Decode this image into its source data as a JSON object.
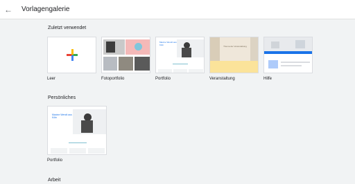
{
  "header": {
    "title": "Vorlagengalerie"
  },
  "sections": [
    {
      "title": "Zuletzt verwendet"
    },
    {
      "title": "Persönliches"
    },
    {
      "title": "Arbeit"
    }
  ],
  "recent": [
    {
      "label": "Leer"
    },
    {
      "label": "Fotoportfolio"
    },
    {
      "label": "Portfolio"
    },
    {
      "label": "Veranstaltung"
    },
    {
      "label": "Hilfe"
    }
  ],
  "personal": [
    {
      "label": "Portfolio"
    }
  ],
  "previews": {
    "portfolio_heading": "Maxine Wendt aus Köln",
    "event_heading": "Thema der Veranstaltung"
  },
  "colors": {
    "plus": [
      "#ea4335",
      "#fbbc04",
      "#34a853",
      "#4285f4"
    ]
  }
}
